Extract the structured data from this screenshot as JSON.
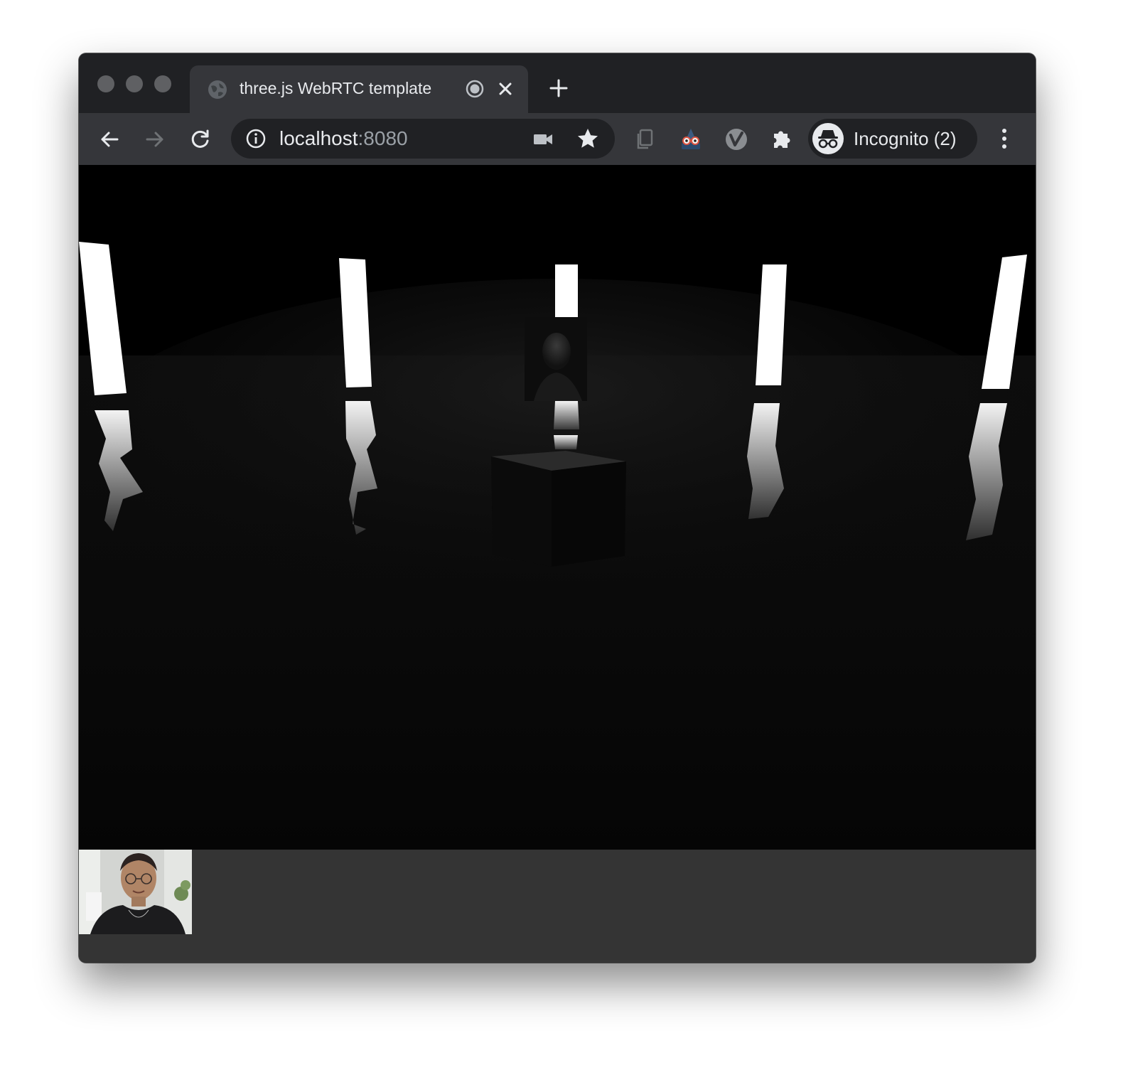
{
  "tab": {
    "title": "three.js WebRTC template"
  },
  "omnibox": {
    "host": "localhost",
    "port": ":8080"
  },
  "profile": {
    "label": "Incognito (2)"
  },
  "icons": {
    "tab_favicon": "globe-icon",
    "tab_recording": "recording-icon",
    "tab_close": "close-icon",
    "new_tab": "plus-icon",
    "back": "arrow-left-icon",
    "forward": "arrow-right-icon",
    "reload": "reload-icon",
    "site_info": "info-icon",
    "camera": "video-camera-icon",
    "bookmark": "star-icon",
    "extension_copy": "copy-icon",
    "extension_glasses": "glasses-extension-icon",
    "extension_v": "v-extension-icon",
    "extensions": "puzzle-icon",
    "incognito": "incognito-icon",
    "menu": "kebab-menu-icon"
  },
  "colors": {
    "chrome_dark": "#202124",
    "chrome_toolbar": "#35363a",
    "text_light": "#e8eaed",
    "text_muted": "#9aa0a6",
    "scene_bg": "#000000",
    "video_bar": "#343434"
  }
}
